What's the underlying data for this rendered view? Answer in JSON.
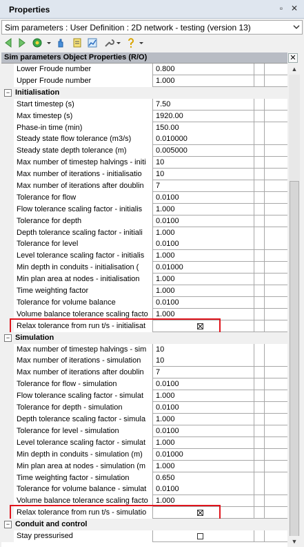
{
  "window": {
    "title": "Properties",
    "pin_glyph": "▫",
    "close_glyph": "✕"
  },
  "dropdown": {
    "value": "Sim parameters : User Definition : 2D network - testing (version 13)"
  },
  "toolbar": {
    "icons": [
      "back-icon",
      "forward-icon",
      "target-icon",
      "hand-icon",
      "notes-icon",
      "chart-icon",
      "wrench-icon",
      "help-icon"
    ]
  },
  "panel": {
    "title": "Sim parameters Object Properties (R/O)",
    "close_glyph": "✕"
  },
  "rows": [
    {
      "type": "row",
      "label": "Lower Froude number",
      "value": "0.800"
    },
    {
      "type": "row",
      "label": "Upper Froude number",
      "value": "1.000"
    },
    {
      "type": "section",
      "label": "Initialisation",
      "toggle": "−"
    },
    {
      "type": "row",
      "label": "Start timestep (s)",
      "value": "7.50"
    },
    {
      "type": "row",
      "label": "Max timestep (s)",
      "value": "1920.00"
    },
    {
      "type": "row",
      "label": "Phase-in time (min)",
      "value": "150.00"
    },
    {
      "type": "row",
      "label": "Steady state flow tolerance (m3/s)",
      "value": "0.010000"
    },
    {
      "type": "row",
      "label": "Steady state depth tolerance (m)",
      "value": "0.005000"
    },
    {
      "type": "row",
      "label": "Max number of timestep halvings - initi",
      "value": "10"
    },
    {
      "type": "row",
      "label": "Max number of iterations - initialisatio",
      "value": "10"
    },
    {
      "type": "row",
      "label": "Max number of iterations after doublin",
      "value": "7"
    },
    {
      "type": "row",
      "label": "Tolerance for flow",
      "value": "0.0100"
    },
    {
      "type": "row",
      "label": "Flow tolerance scaling factor - initialis",
      "value": "1.000"
    },
    {
      "type": "row",
      "label": "Tolerance for depth",
      "value": "0.0100"
    },
    {
      "type": "row",
      "label": "Depth tolerance scaling factor - initiali",
      "value": "1.000"
    },
    {
      "type": "row",
      "label": "Tolerance for level",
      "value": "0.0100"
    },
    {
      "type": "row",
      "label": "Level tolerance scaling factor - initialis",
      "value": "1.000"
    },
    {
      "type": "row",
      "label": "Min depth in conduits - initialisation (",
      "value": "0.01000"
    },
    {
      "type": "row",
      "label": "Min plan area at nodes - initialisation",
      "value": "1.000"
    },
    {
      "type": "row",
      "label": "Time weighting factor",
      "value": "1.000"
    },
    {
      "type": "row",
      "label": "Tolerance for volume balance",
      "value": "0.0100"
    },
    {
      "type": "row",
      "label": "Volume balance tolerance scaling facto",
      "value": "1.000"
    },
    {
      "type": "check",
      "label": "Relax tolerance from run t/s - initialisat",
      "checked": true,
      "highlight": true
    },
    {
      "type": "section",
      "label": "Simulation",
      "toggle": "−"
    },
    {
      "type": "row",
      "label": "Max number of timestep halvings - sim",
      "value": "10"
    },
    {
      "type": "row",
      "label": "Max number of iterations - simulation",
      "value": "10"
    },
    {
      "type": "row",
      "label": "Max number of iterations after doublin",
      "value": "7"
    },
    {
      "type": "row",
      "label": "Tolerance for flow - simulation",
      "value": "0.0100"
    },
    {
      "type": "row",
      "label": "Flow tolerance scaling factor - simulat",
      "value": "1.000"
    },
    {
      "type": "row",
      "label": "Tolerance for depth - simulation",
      "value": "0.0100"
    },
    {
      "type": "row",
      "label": "Depth tolerance scaling factor - simula",
      "value": "1.000"
    },
    {
      "type": "row",
      "label": "Tolerance for level - simulation",
      "value": "0.0100"
    },
    {
      "type": "row",
      "label": "Level tolerance scaling factor - simulat",
      "value": "1.000"
    },
    {
      "type": "row",
      "label": "Min depth in conduits - simulation (m)",
      "value": "0.01000"
    },
    {
      "type": "row",
      "label": "Min plan area at nodes - simulation (m",
      "value": "1.000"
    },
    {
      "type": "row",
      "label": "Time weighting factor - simulation",
      "value": "0.650"
    },
    {
      "type": "row",
      "label": "Tolerance for volume balance - simulat",
      "value": "0.0100"
    },
    {
      "type": "row",
      "label": "Volume balance tolerance scaling facto",
      "value": "1.000"
    },
    {
      "type": "check",
      "label": "Relax tolerance from run t/s - simulatio",
      "checked": true,
      "highlight": true
    },
    {
      "type": "section",
      "label": "Conduit and control",
      "toggle": "−"
    },
    {
      "type": "check",
      "label": "Stay pressurised",
      "checked": false,
      "highlight": false
    }
  ],
  "colors": {
    "highlight": "#e0141c",
    "titlebar": "#dfe6ef",
    "panel_header": "#b8bcc4"
  }
}
